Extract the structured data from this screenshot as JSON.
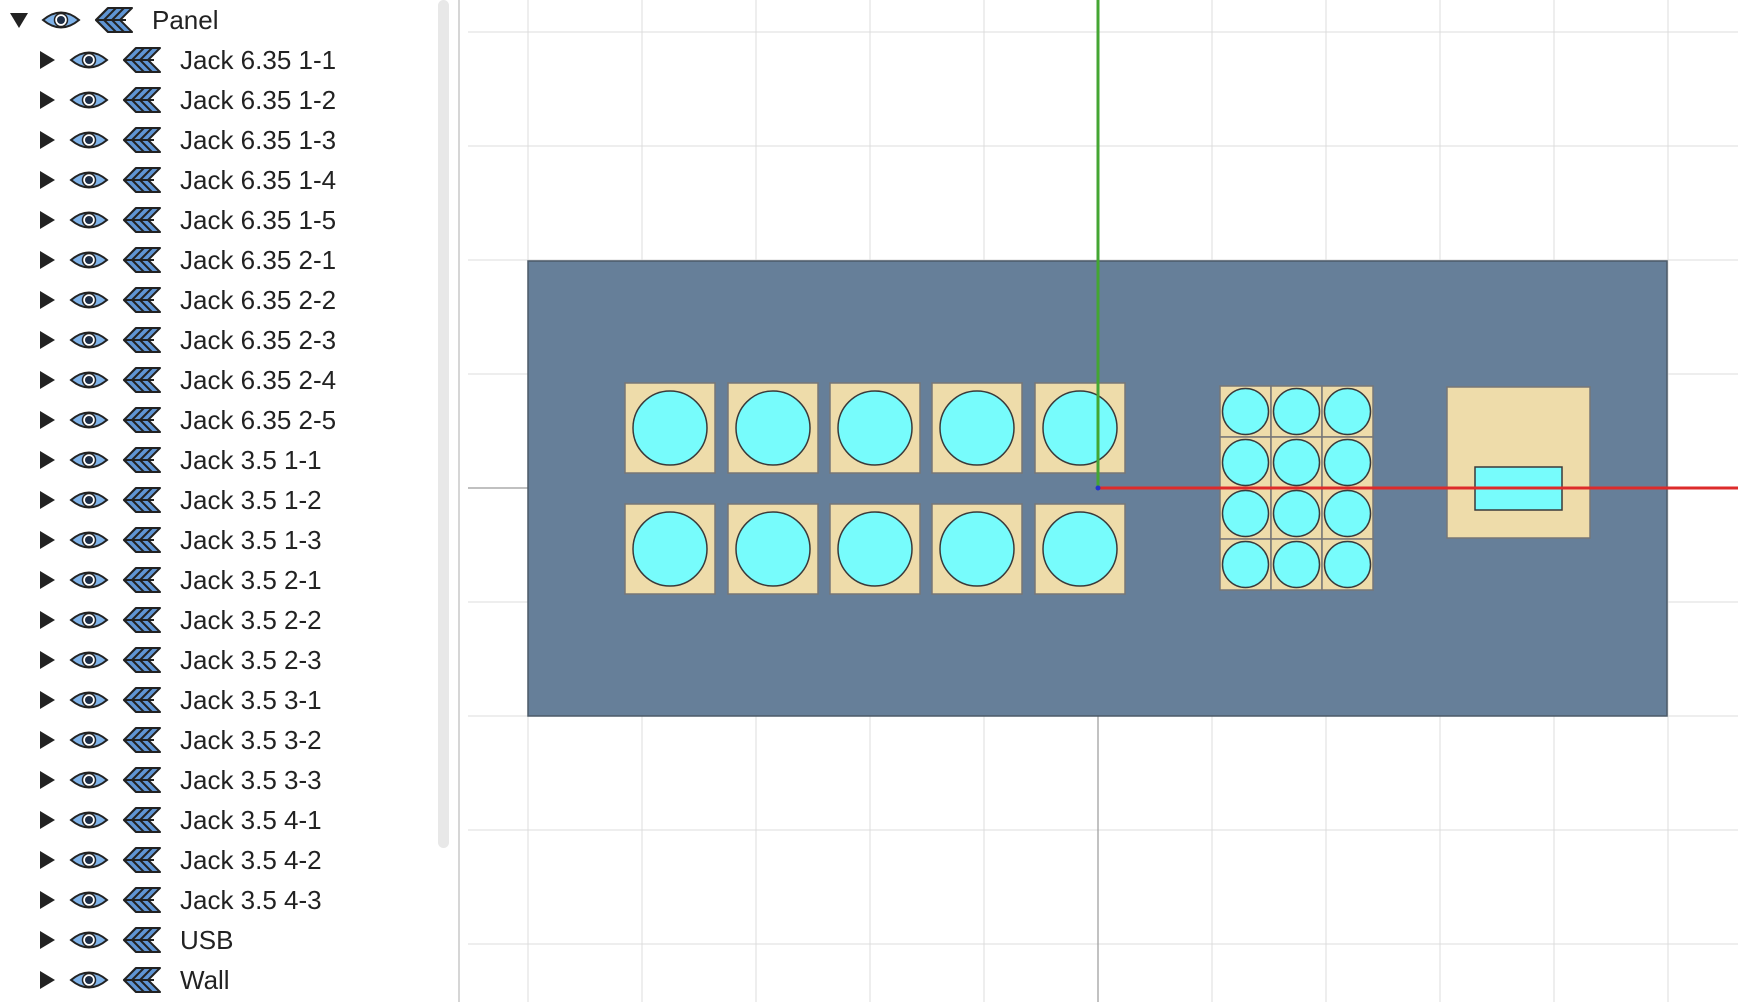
{
  "tree": {
    "root": {
      "label": "Panel",
      "expanded": true
    },
    "children": [
      {
        "label": "Jack 6.35 1-1"
      },
      {
        "label": "Jack 6.35 1-2"
      },
      {
        "label": "Jack 6.35 1-3"
      },
      {
        "label": "Jack 6.35 1-4"
      },
      {
        "label": "Jack 6.35 1-5"
      },
      {
        "label": "Jack 6.35 2-1"
      },
      {
        "label": "Jack 6.35 2-2"
      },
      {
        "label": "Jack 6.35 2-3"
      },
      {
        "label": "Jack 6.35 2-4"
      },
      {
        "label": "Jack 6.35 2-5"
      },
      {
        "label": "Jack 3.5 1-1"
      },
      {
        "label": "Jack 3.5 1-2"
      },
      {
        "label": "Jack 3.5 1-3"
      },
      {
        "label": "Jack 3.5 2-1"
      },
      {
        "label": "Jack 3.5 2-2"
      },
      {
        "label": "Jack 3.5 2-3"
      },
      {
        "label": "Jack 3.5 3-1"
      },
      {
        "label": "Jack 3.5 3-2"
      },
      {
        "label": "Jack 3.5 3-3"
      },
      {
        "label": "Jack 3.5 4-1"
      },
      {
        "label": "Jack 3.5 4-2"
      },
      {
        "label": "Jack 3.5 4-3"
      },
      {
        "label": "USB"
      },
      {
        "label": "Wall"
      }
    ],
    "icons": {
      "expanded": "triangle-down-icon",
      "collapsed": "triangle-right-icon",
      "visibility": "eye-icon",
      "layer": "layers-icon"
    }
  },
  "viewport": {
    "colors": {
      "grid": "#dcdcdc",
      "panel": "#667f99",
      "jack_socket": "#eedcaa",
      "jack_hole": "#77fcfc",
      "usb_socket": "#eedcaa",
      "usb_port": "#77fcfc",
      "x_axis": "#dd2b2b",
      "y_axis": "#44a633"
    }
  }
}
